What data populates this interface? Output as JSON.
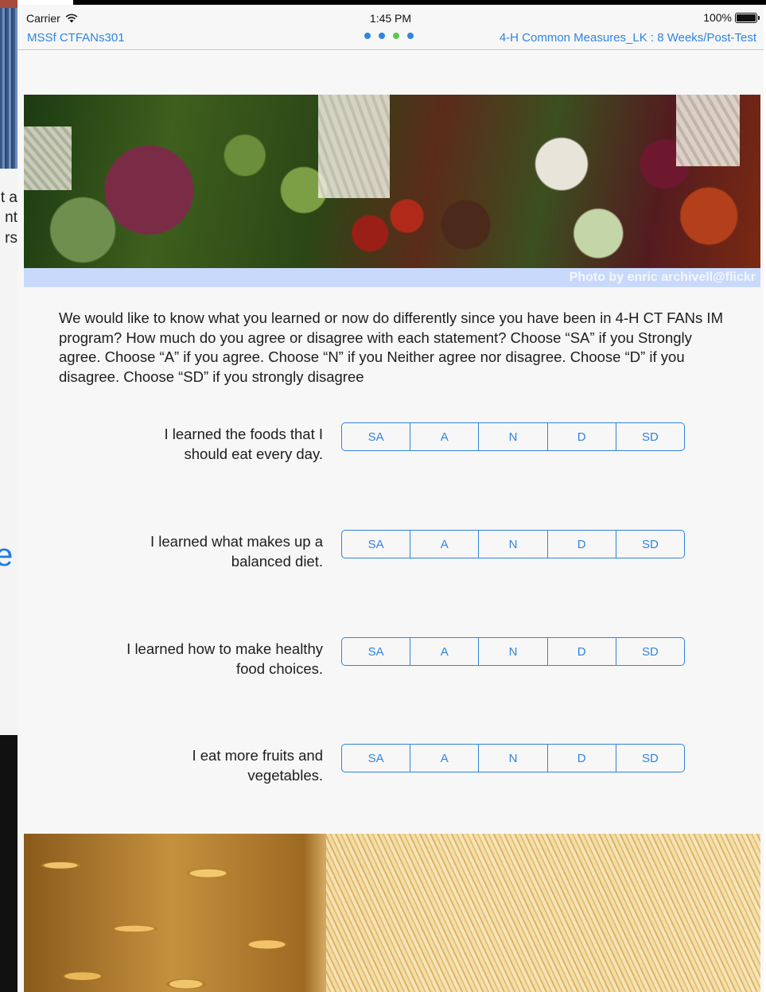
{
  "background": {
    "fragments": [
      "t a",
      "nt",
      "rs"
    ],
    "big_letter": "e"
  },
  "status_bar": {
    "carrier": "Carrier",
    "time": "1:45 PM",
    "battery": "100%"
  },
  "nav": {
    "left_title": "MSSf CTFANs301",
    "right_title": "4-H Common Measures_LK : 8 Weeks/Post-Test",
    "page_count": 4,
    "active_page": 3
  },
  "hero": {
    "caption": "Photo by enric archivell@flickr"
  },
  "intro": {
    "text": "We would like to know what you learned or now do differently since you have been in 4-H CT FANs IM program? How much do you agree or disagree with each statement? Choose “SA” if you Strongly agree. Choose “A” if you agree. Choose “N” if you Neither agree nor disagree. Choose “D” if you disagree.  Choose “SD” if you strongly disagree"
  },
  "options": [
    "SA",
    "A",
    "N",
    "D",
    "SD"
  ],
  "questions": [
    {
      "line1": "I learned the foods that I",
      "line2": "should eat every day."
    },
    {
      "line1": "I learned what makes up a",
      "line2": "balanced diet."
    },
    {
      "line1": "I learned how to make healthy",
      "line2": "food choices."
    },
    {
      "line1": "I eat more fruits and",
      "line2": "vegetables."
    }
  ],
  "colors": {
    "accent": "#2f84e0",
    "active_dot": "#5cc94c",
    "caption_bar": "#c9d9fb"
  }
}
